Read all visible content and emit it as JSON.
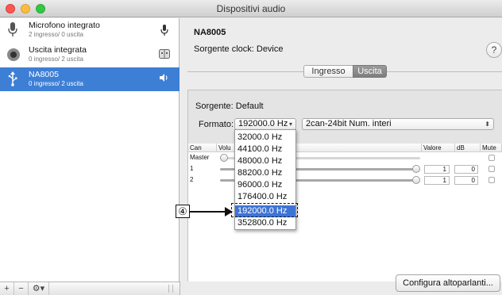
{
  "window": {
    "title": "Dispositivi audio"
  },
  "sidebar": {
    "devices": [
      {
        "name": "Microfono integrato",
        "sub": "2 ingresso/ 0 uscita",
        "icon": "microphone-icon",
        "badge": "mic-badge-icon"
      },
      {
        "name": "Uscita integrata",
        "sub": "0 ingresso/ 2 uscita",
        "icon": "speaker-icon",
        "badge": "finder-badge-icon"
      },
      {
        "name": "NA8005",
        "sub": "0 ingresso/ 2 uscita",
        "icon": "usb-icon",
        "badge": "volume-icon",
        "selected": true
      }
    ],
    "bottom": {
      "add": "+",
      "remove": "−",
      "gear": "⚙▾"
    }
  },
  "main": {
    "device_title": "NA8005",
    "clock_source": "Sorgente clock: Device",
    "help": "?",
    "tabs": {
      "input": "Ingresso",
      "output": "Uscita"
    },
    "source_label": "Sorgente: Default",
    "format_label": "Formato:",
    "format_value": "192000.0 Hz",
    "format_type": "2can-24bit Num. interi",
    "table": {
      "headers": [
        "Can",
        "Volu",
        "Valore",
        "dB",
        "Mute"
      ],
      "rows": [
        {
          "label": "Master",
          "value": "",
          "db": ""
        },
        {
          "label": "1",
          "value": "1",
          "db": "0"
        },
        {
          "label": "2",
          "value": "1",
          "db": "0"
        }
      ]
    },
    "configure_button": "Configura altoparlanti..."
  },
  "menu": {
    "items": [
      "32000.0 Hz",
      "44100.0 Hz",
      "48000.0 Hz",
      "88200.0 Hz",
      "96000.0 Hz",
      "176400.0 Hz",
      "192000.0 Hz",
      "352800.0 Hz"
    ],
    "highlighted_index": 6
  },
  "callout": {
    "number": "④"
  },
  "colors": {
    "selection": "#3e7fd6",
    "menu_highlight": "#3e73d6"
  }
}
